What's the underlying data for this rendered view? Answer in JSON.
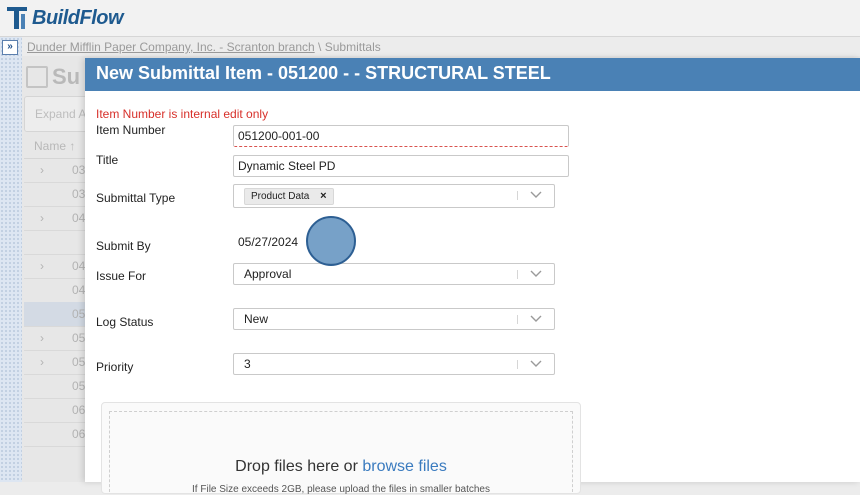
{
  "app": {
    "name": "BuildFlow"
  },
  "breadcrumb": {
    "company": "Dunder Mifflin Paper Company, Inc. - Scranton branch",
    "sep": "\\",
    "section": "Submittals"
  },
  "background": {
    "title": "Su",
    "toolbar_label": "Expand A",
    "name_header": "Name ↑",
    "rows": [
      {
        "chev": "›",
        "num": "03"
      },
      {
        "chev": "",
        "num": "03"
      },
      {
        "chev": "›",
        "num": "04"
      },
      {
        "chev": "",
        "num": ""
      },
      {
        "chev": "›",
        "num": "04"
      },
      {
        "chev": "",
        "num": "04"
      },
      {
        "chev": "",
        "num": "05"
      },
      {
        "chev": "›",
        "num": "05"
      },
      {
        "chev": "›",
        "num": "05"
      },
      {
        "chev": "",
        "num": "05"
      },
      {
        "chev": "",
        "num": "06"
      },
      {
        "chev": "",
        "num": "06"
      }
    ]
  },
  "modal": {
    "title": "New Submittal Item - 051200 - - STRUCTURAL STEEL",
    "error_note": "Item Number is internal edit only",
    "fields": {
      "item_number": {
        "label": "Item Number",
        "value": "051200-001-00"
      },
      "title": {
        "label": "Title",
        "value": "Dynamic Steel PD"
      },
      "submittal_type": {
        "label": "Submittal Type",
        "chip": "Product Data",
        "chip_remove": "×"
      },
      "submit_by": {
        "label": "Submit By",
        "value": "05/27/2024"
      },
      "issue_for": {
        "label": "Issue For",
        "value": "Approval"
      },
      "log_status": {
        "label": "Log Status",
        "value": "New"
      },
      "priority": {
        "label": "Priority",
        "value": "3"
      }
    },
    "dropzone": {
      "text": "Drop files here or",
      "link": "browse files",
      "subtext": "If File Size exceeds 2GB, please upload the files in smaller batches"
    }
  },
  "colors": {
    "header": "#4a81b5",
    "error": "#d7302a",
    "link": "#3a7bbf"
  }
}
